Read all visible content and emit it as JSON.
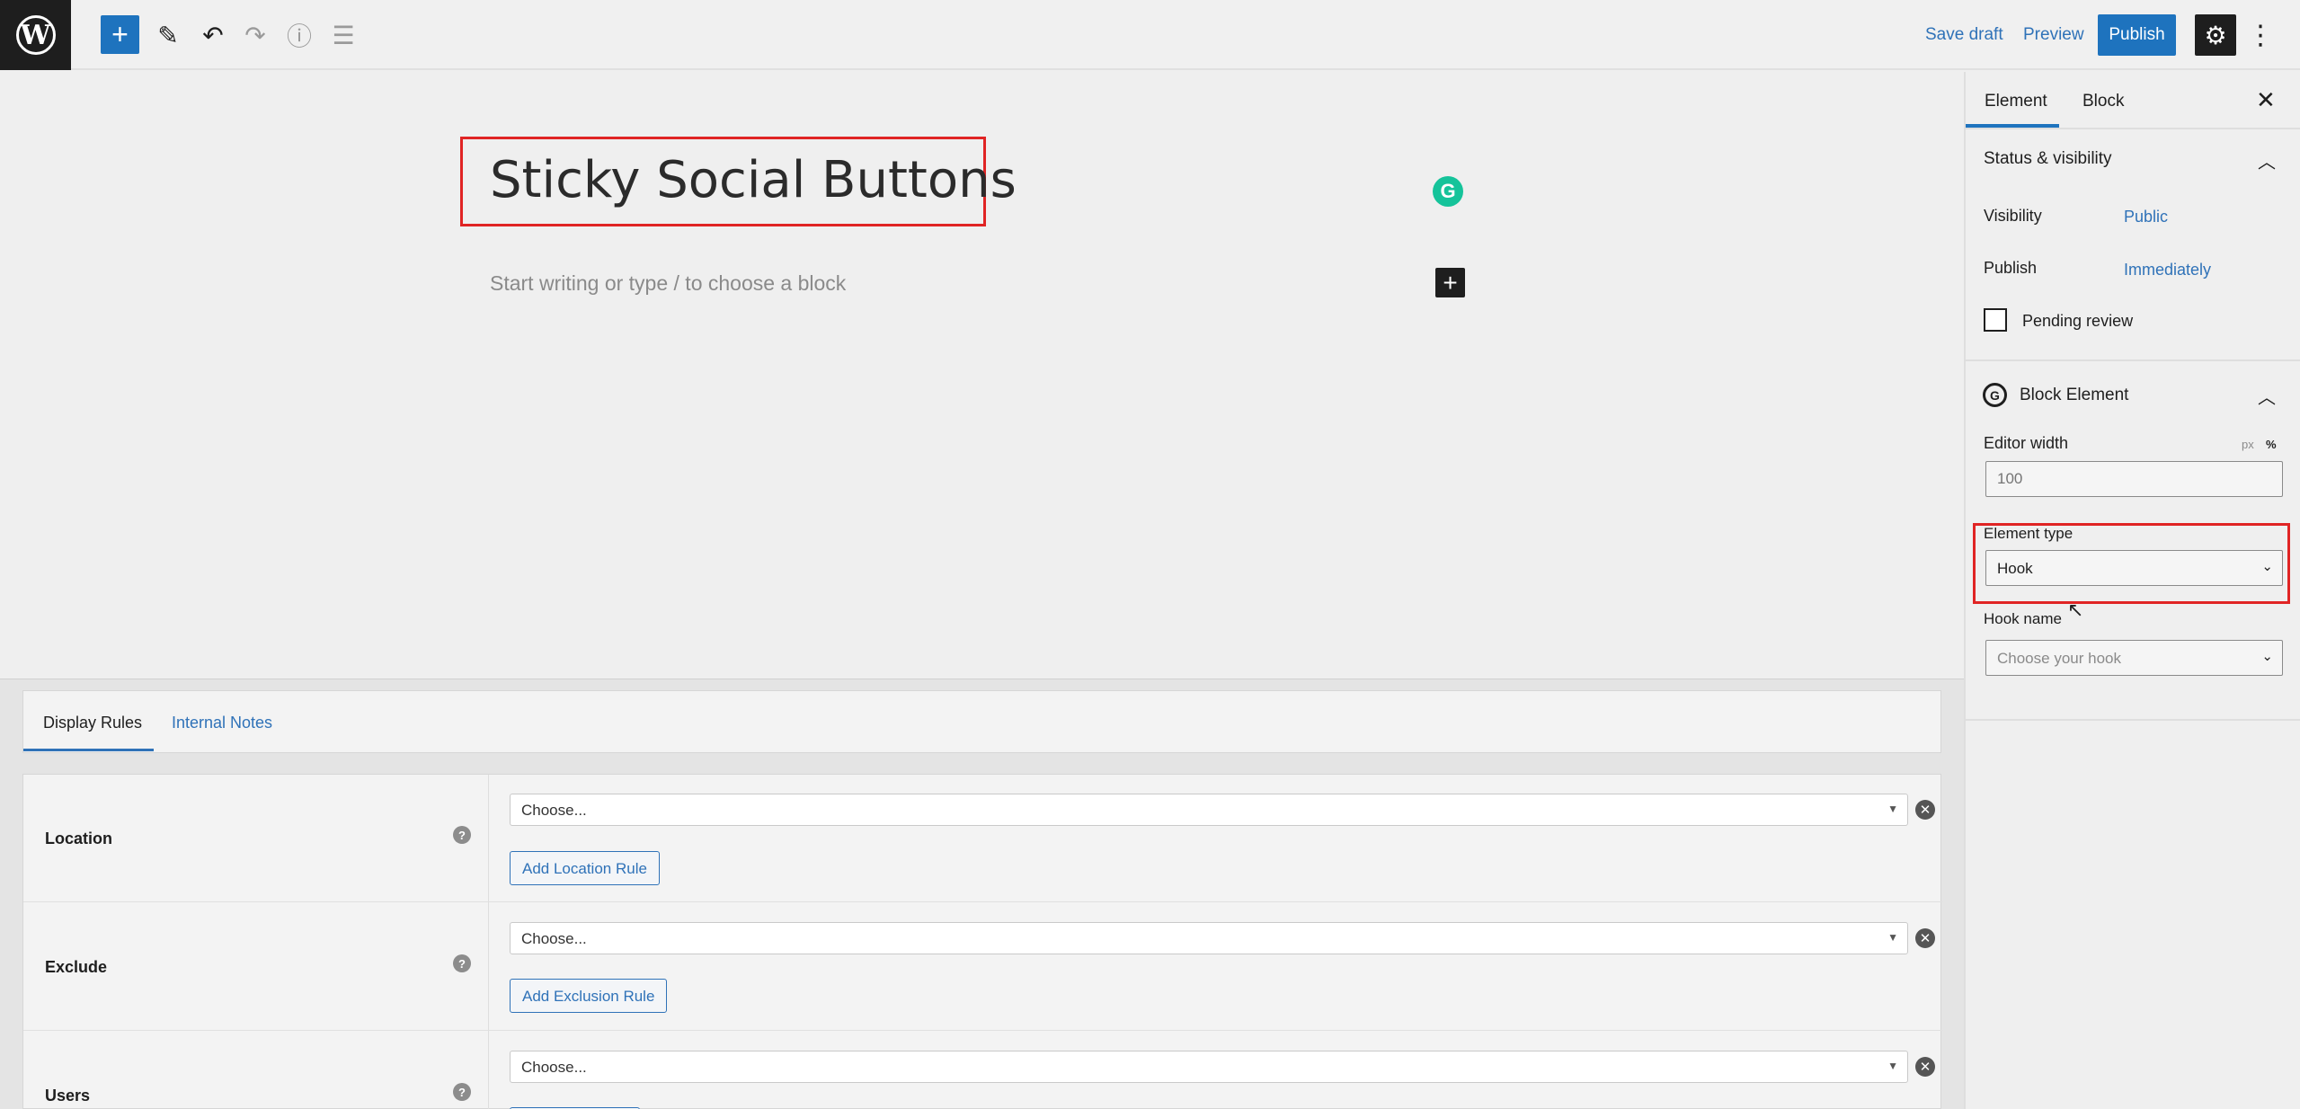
{
  "toolbar": {
    "logo_letter": "W",
    "add_icon": "+",
    "edit_icon": "✎",
    "undo_icon": "↶",
    "redo_icon": "↷",
    "info_icon": "ⓘ",
    "list_view_icon": "☰",
    "save_draft": "Save draft",
    "preview": "Preview",
    "publish": "Publish",
    "settings_icon": "⚙",
    "more_icon": "⋮"
  },
  "editor": {
    "title": "Sticky Social Buttons",
    "placeholder": "Start writing or type / to choose a block",
    "grammarly_icon": "G",
    "inline_add_icon": "+"
  },
  "sidebar": {
    "tabs": [
      "Element",
      "Block"
    ],
    "active_tab": "Element",
    "close_icon": "✕",
    "status_section": {
      "title": "Status & visibility",
      "visibility_label": "Visibility",
      "visibility_value": "Public",
      "publish_label": "Publish",
      "publish_value": "Immediately",
      "pending_review": "Pending review"
    },
    "block_element": {
      "title": "Block Element",
      "icon": "G",
      "editor_width_label": "Editor width",
      "unit_px": "px",
      "unit_pct": "%",
      "editor_width_placeholder": "100",
      "element_type_label": "Element type",
      "element_type_value": "Hook",
      "hook_name_label": "Hook name",
      "hook_name_value": "Choose your hook"
    },
    "chevron_up": "︿",
    "chevron_down": "⌄"
  },
  "meta": {
    "tabs": [
      "Display Rules",
      "Internal Notes"
    ],
    "active_tab": "Display Rules",
    "help_icon": "?",
    "remove_icon": "✕",
    "dropdown_arrow": "▼",
    "rules": [
      {
        "label": "Location",
        "select": "Choose...",
        "button": "Add Location Rule"
      },
      {
        "label": "Exclude",
        "select": "Choose...",
        "button": "Add Exclusion Rule"
      },
      {
        "label": "Users",
        "select": "Choose...",
        "button": ""
      }
    ]
  },
  "colors": {
    "accent": "#1e73be",
    "link": "#2f72b8",
    "highlight": "#e02424",
    "dark": "#1e1e1e",
    "grammarly": "#15c39a"
  }
}
